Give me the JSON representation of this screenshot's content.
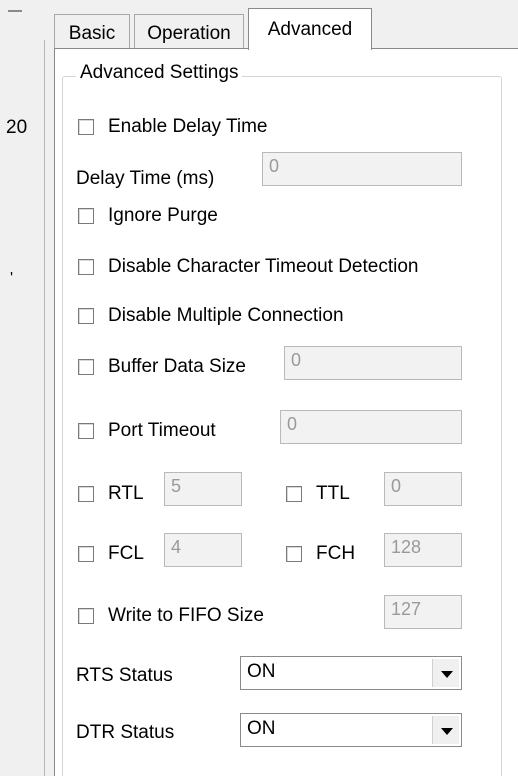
{
  "side": {
    "frag1": "20",
    "frag2": "'"
  },
  "tabs": [
    {
      "label": "Basic"
    },
    {
      "label": "Operation"
    },
    {
      "label": "Advanced"
    }
  ],
  "group": {
    "legend": "Advanced Settings"
  },
  "enable_delay": {
    "label": "Enable Delay Time",
    "checked": false
  },
  "delay_time": {
    "label": "Delay Time (ms)",
    "value": "0"
  },
  "ignore_purge": {
    "label": "Ignore Purge",
    "checked": false
  },
  "disable_char_timeout": {
    "label": "Disable Character Timeout Detection",
    "checked": false
  },
  "disable_multi": {
    "label": "Disable Multiple Connection",
    "checked": false
  },
  "buffer_size": {
    "label": "Buffer Data Size",
    "value": "0",
    "checked": false
  },
  "port_timeout": {
    "label": "Port Timeout",
    "value": "0",
    "checked": false
  },
  "rtl": {
    "label": "RTL",
    "value": "5",
    "checked": false
  },
  "ttl": {
    "label": "TTL",
    "value": "0",
    "checked": false
  },
  "fcl": {
    "label": "FCL",
    "value": "4",
    "checked": false
  },
  "fch": {
    "label": "FCH",
    "value": "128",
    "checked": false
  },
  "fifo": {
    "label": "Write to FIFO Size",
    "value": "127",
    "checked": false
  },
  "rts": {
    "label": "RTS Status",
    "value": "ON"
  },
  "dtr": {
    "label": "DTR Status",
    "value": "ON"
  }
}
